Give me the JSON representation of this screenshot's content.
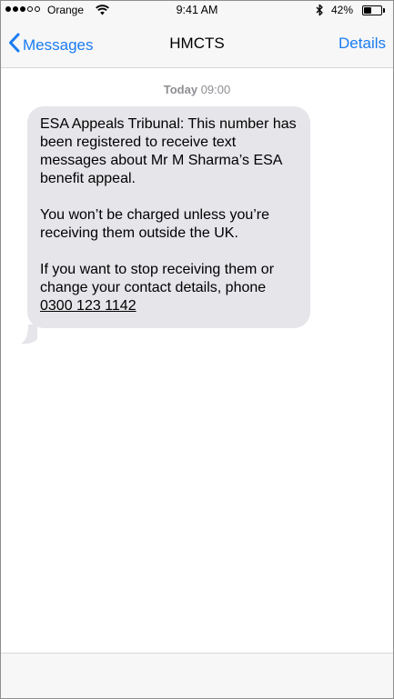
{
  "status_bar": {
    "signal_filled": 3,
    "signal_total": 5,
    "carrier": "Orange",
    "time": "9:41 AM",
    "battery_pct": "42%",
    "battery_level": 0.42
  },
  "nav": {
    "back_label": "Messages",
    "title": "HMCTS",
    "details_label": "Details",
    "accent_color": "#1a7cf2"
  },
  "conversation": {
    "timestamp_day": "Today",
    "timestamp_time": "09:00",
    "message": {
      "paragraph_1": "ESA Appeals Tribunal: This number has been registered to receive text messages about Mr M Sharma’s ESA benefit appeal.",
      "paragraph_2": "You won’t be charged unless you’re receiving them outside the UK.",
      "paragraph_3_text": "If you want to stop receiving them or change your contact details, phone",
      "phone_number": "0300 123 1142",
      "bubble_color": "#e5e5ea"
    }
  },
  "icons": {
    "back": "chevron-left-icon",
    "wifi": "wifi-icon",
    "bluetooth": "bluetooth-icon",
    "battery": "battery-icon"
  }
}
